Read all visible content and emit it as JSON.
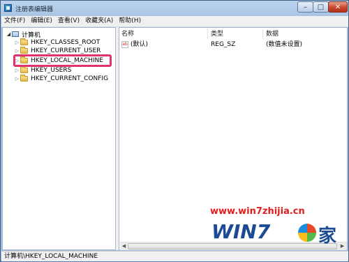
{
  "window": {
    "title": "注册表编辑器",
    "controls": {
      "minimize": "–",
      "maximize": "□",
      "close": "✕"
    }
  },
  "menu": [
    "文件(F)",
    "编辑(E)",
    "查看(V)",
    "收藏夹(A)",
    "帮助(H)"
  ],
  "tree": {
    "root": "计算机",
    "items": [
      {
        "label": "HKEY_CLASSES_ROOT"
      },
      {
        "label": "HKEY_CURRENT_USER"
      },
      {
        "label": "HKEY_LOCAL_MACHINE",
        "highlighted": true
      },
      {
        "label": "HKEY_USERS"
      },
      {
        "label": "HKEY_CURRENT_CONFIG"
      }
    ]
  },
  "list": {
    "columns": [
      "名称",
      "类型",
      "数据"
    ],
    "rows": [
      {
        "name": "(默认)",
        "type": "REG_SZ",
        "data": "(数值未设置)",
        "icon": "ab-string-icon"
      }
    ]
  },
  "statusbar": {
    "path": "计算机\\HKEY_LOCAL_MACHINE"
  },
  "watermark": {
    "url": "www.win7zhijia.cn",
    "logo_text": "WIN7",
    "logo_cn": "家"
  },
  "colors": {
    "highlight_box": "#e0326d",
    "watermark_red": "#e01c1c",
    "watermark_blue": "#1b4b93"
  }
}
